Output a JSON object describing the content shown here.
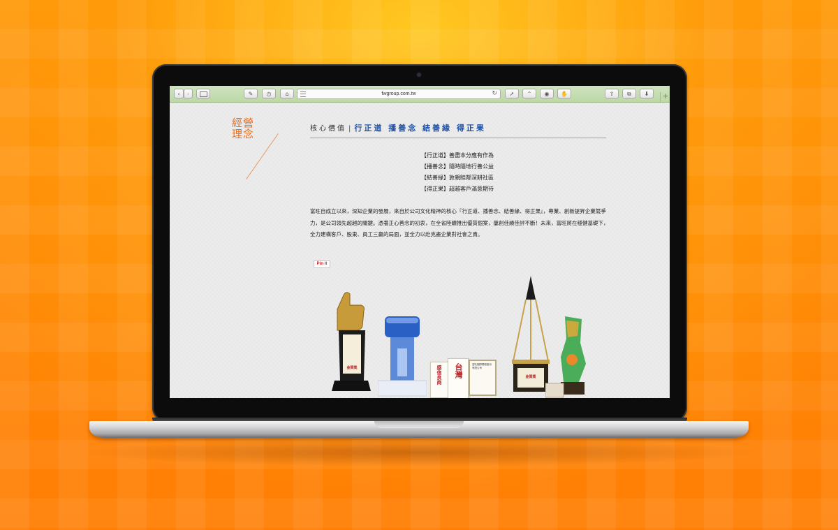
{
  "browser": {
    "url": "fwgroup.com.tw",
    "new_tab_label": "+"
  },
  "page": {
    "section_title": "經營\n理念",
    "values_label": "核心價值",
    "values_separator": "|",
    "motto": "行正道 播善念 結善緣 得正果",
    "principles": [
      "【行正道】善盡本分應有作為",
      "【播善念】隨時隨地行善公益",
      "【結善緣】敦親睦鄰深耕社區",
      "【得正果】超越客戶滿意期待"
    ],
    "description": "富旺自成立以來，深知企業的發展，來自於公司文化精神的核心『行正道、播善念、結善緣、得正果』，專業、創新提昇企業競爭力，是公司領先超越的關鍵。憑著正心善念的初衷，在全省陸續推出優質個案，屢創佳績佳評不斷！未來，富旺將在穩健基礎下，全力建構客戶、股東、員工三贏的局面，並全力以赴克盡企業對社會之責。",
    "pin_label": "Pin it",
    "trophy_labels": {
      "award_1": "金質獎",
      "plaque_1": "感信良商",
      "plaque_2": "台灣",
      "plaque_3": "富旺國際開發股份有限公司",
      "award_2": "金質獎"
    }
  },
  "colors": {
    "background_orange": "#ff8a06",
    "accent_orange": "#e86c1c",
    "motto_blue": "#1e4fa3",
    "toolbar_green": "#c6ddb2"
  }
}
